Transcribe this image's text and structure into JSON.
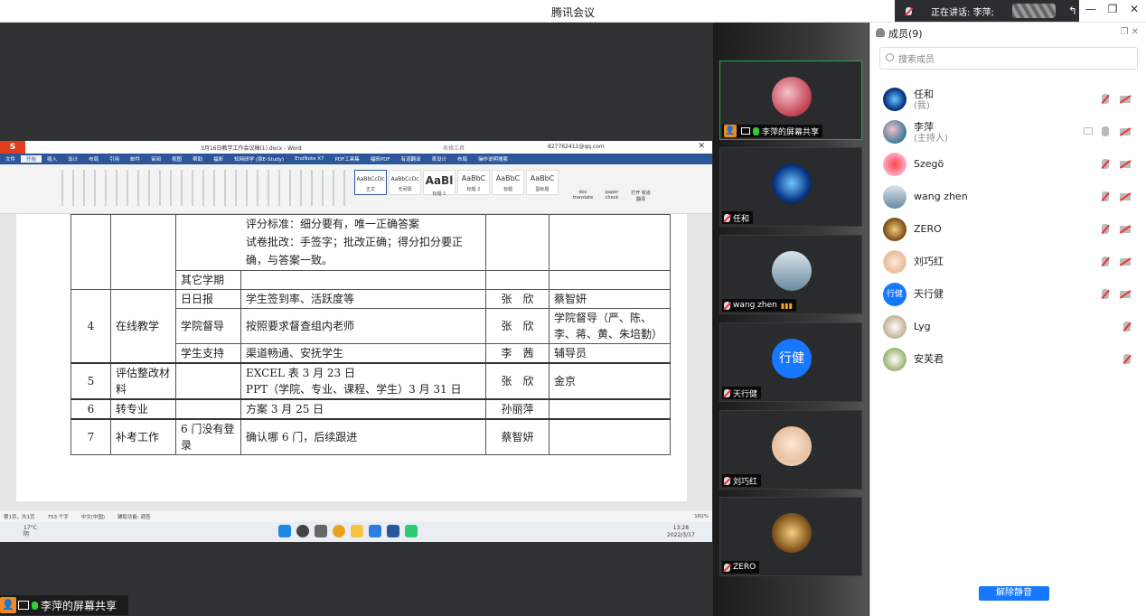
{
  "window": {
    "title": "腾讯会议"
  },
  "speaking": {
    "label": "正在讲话: 李萍;"
  },
  "word": {
    "doc_title": "3月16日教学工作会议稿(1).docx - Word",
    "tool_tab": "表格工具",
    "account": "827762411@qq.com",
    "tabs": [
      "文件",
      "开始",
      "插入",
      "设计",
      "布局",
      "引用",
      "邮件",
      "审阅",
      "视图",
      "帮助",
      "福昕",
      "知网研学 (原E-Study)",
      "EndNote X7",
      "PDF工具集",
      "福昕PDF",
      "有道翻译",
      "表设计",
      "布局",
      "操作说明搜索"
    ],
    "styles": [
      {
        "sample": "AaBbCcDc",
        "name": "正文"
      },
      {
        "sample": "AaBbCcDc",
        "name": "无间隔"
      },
      {
        "sample": "AaBl",
        "name": "标题 1"
      },
      {
        "sample": "AaBbC",
        "name": "标题 2"
      },
      {
        "sample": "AaBbC",
        "name": "标题"
      },
      {
        "sample": "AaBbC",
        "name": "副标题"
      }
    ],
    "ribbon_right": [
      "doc translate",
      "paper check",
      "打开 有道翻译"
    ],
    "table": {
      "cont_lines": [
        "评分标准：细分要有，唯一正确答案",
        "试卷批改：手签字；批改正确；得分扣分要正",
        "确，与答案一致。"
      ],
      "other": "其它学期",
      "rows": [
        {
          "num": "4",
          "cat": "在线教学",
          "items": [
            {
              "sub": "日日报",
              "content": "学生签到率、活跃度等",
              "owner": "张　欣",
              "helper": "蔡智妍"
            },
            {
              "sub": "学院督导",
              "content": "按照要求督查组内老师",
              "owner": "张　欣",
              "helper": "学院督导（严、陈、李、蒋、黄、朱培勤）"
            },
            {
              "sub": "学生支持",
              "content": "渠道畅通、安抚学生",
              "owner": "李　茜",
              "helper": "辅导员"
            }
          ]
        },
        {
          "num": "5",
          "cat": "评估整改材料",
          "sub": "",
          "content1": "EXCEL 表 3 月 23 日",
          "content2": "PPT（学院、专业、课程、学生）3 月 31 日",
          "owner": "张　欣",
          "helper": "金京"
        },
        {
          "num": "6",
          "cat": "转专业",
          "sub": "",
          "content": "方案 3 月 25 日",
          "owner": "孙丽萍",
          "helper": ""
        },
        {
          "num": "7",
          "cat": "补考工作",
          "sub": "6 门没有登录",
          "content": "确认哪 6 门，后续跟进",
          "owner": "蔡智妍",
          "helper": ""
        }
      ]
    },
    "status": {
      "page": "第1页，共1页",
      "words": "753 个字",
      "lang": "中文(中国)",
      "access": "辅助功能: 调查",
      "zoom": "182%"
    },
    "taskbar": {
      "weather": "17°C",
      "weather_desc": "阴",
      "time": "13:28",
      "date": "2022/3/17"
    }
  },
  "share_label": "李萍的屏幕共享",
  "videos": [
    {
      "name": "李萍的屏幕共享",
      "type": "share"
    },
    {
      "name": "任和"
    },
    {
      "name": "wang zhen"
    },
    {
      "name": "天行健",
      "avatar_text": "行健"
    },
    {
      "name": "刘巧红"
    },
    {
      "name": "ZERO"
    }
  ],
  "members": {
    "title": "成员(9)",
    "search_placeholder": "搜索成员",
    "list": [
      {
        "name": "任和",
        "sub": "(我)",
        "color": "#1e6fd9"
      },
      {
        "name": "李萍",
        "sub": "(主持人)",
        "color": "#3a7a9a"
      },
      {
        "name": "Szegö",
        "color": "#e0442c"
      },
      {
        "name": "wang zhen",
        "color": "#7a9bb0"
      },
      {
        "name": "ZERO",
        "color": "#c8a050"
      },
      {
        "name": "刘巧红",
        "color": "#e0c0a0"
      },
      {
        "name": "天行健",
        "avatar_text": "行健",
        "color": "#1677ff"
      },
      {
        "name": "Lyg",
        "color": "#c0b090"
      },
      {
        "name": "安芙君",
        "color": "#9bb070"
      }
    ],
    "unmute_all": "解除静音"
  }
}
